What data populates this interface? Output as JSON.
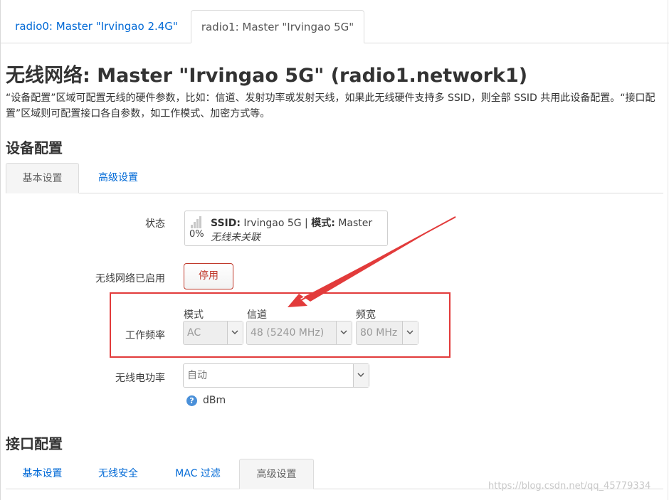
{
  "radio_tabs": [
    {
      "label": "radio0: Master \"Irvingao 2.4G\""
    },
    {
      "label": "radio1: Master \"Irvingao 5G\""
    }
  ],
  "page_title": "无线网络: Master \"Irvingao 5G\" (radio1.network1)",
  "description": "“设备配置”区域可配置无线的硬件参数，比如：信道、发射功率或发射天线，如果此无线硬件支持多 SSID，则全部 SSID 共用此设备配置。“接口配置”区域则可配置接口各自参数，如工作模式、加密方式等。",
  "device_section": {
    "title": "设备配置",
    "tabs": [
      {
        "label": "基本设置"
      },
      {
        "label": "高级设置"
      }
    ],
    "status_label": "状态",
    "status": {
      "signal_pct": "0%",
      "ssid_key": "SSID:",
      "ssid_value": "Irvingao 5G",
      "separator": "|",
      "mode_key": "模式:",
      "mode_value": "Master",
      "association": "无线未关联"
    },
    "enabled_label": "无线网络已启用",
    "disable_button": "停用",
    "freq_label": "工作频率",
    "freq": {
      "mode_label": "模式",
      "mode_value": "AC",
      "channel_label": "信道",
      "channel_value": "48 (5240 MHz)",
      "width_label": "频宽",
      "width_value": "80 MHz"
    },
    "power_label": "无线电功率",
    "power_value": "自动",
    "power_unit": "dBm"
  },
  "interface_section": {
    "title": "接口配置",
    "tabs": [
      {
        "label": "基本设置"
      },
      {
        "label": "无线安全"
      },
      {
        "label": "MAC 过滤"
      },
      {
        "label": "高级设置"
      }
    ]
  },
  "watermark": "https://blog.csdn.net/qq_45779334",
  "colors": {
    "link": "#0069d6",
    "danger": "#c0392b",
    "annotation": "#e23b3b"
  }
}
